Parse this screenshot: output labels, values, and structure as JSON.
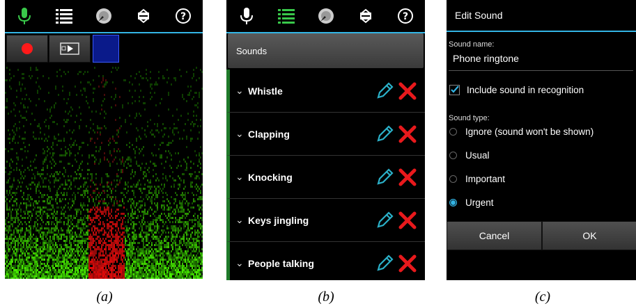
{
  "panel_a": {
    "caption": "(a)",
    "icons": [
      "microphone-icon",
      "list-icon",
      "sound-disc-icon",
      "settings-icon",
      "help-icon"
    ],
    "controls": [
      "record-button",
      "playback-button",
      "color-swatch"
    ]
  },
  "panel_b": {
    "caption": "(b)",
    "header": "Sounds",
    "items": [
      {
        "label": "Whistle"
      },
      {
        "label": "Clapping"
      },
      {
        "label": "Knocking"
      },
      {
        "label": "Keys jingling"
      },
      {
        "label": "People talking"
      }
    ]
  },
  "panel_c": {
    "caption": "(c)",
    "title": "Edit Sound",
    "name_label": "Sound name:",
    "name_value": "Phone ringtone",
    "include_label": "Include sound in recognition",
    "include_checked": true,
    "type_label": "Sound type:",
    "types": [
      {
        "label": "Ignore (sound won't be shown)",
        "selected": false
      },
      {
        "label": "Usual",
        "selected": false
      },
      {
        "label": "Important",
        "selected": false
      },
      {
        "label": "Urgent",
        "selected": true
      }
    ],
    "cancel": "Cancel",
    "ok": "OK"
  },
  "colors": {
    "accent": "#33b5e5",
    "mic_active": "#39c84a",
    "list_active": "#39c84a",
    "delete": "#e8191c",
    "edit": "#2bb0c8"
  }
}
